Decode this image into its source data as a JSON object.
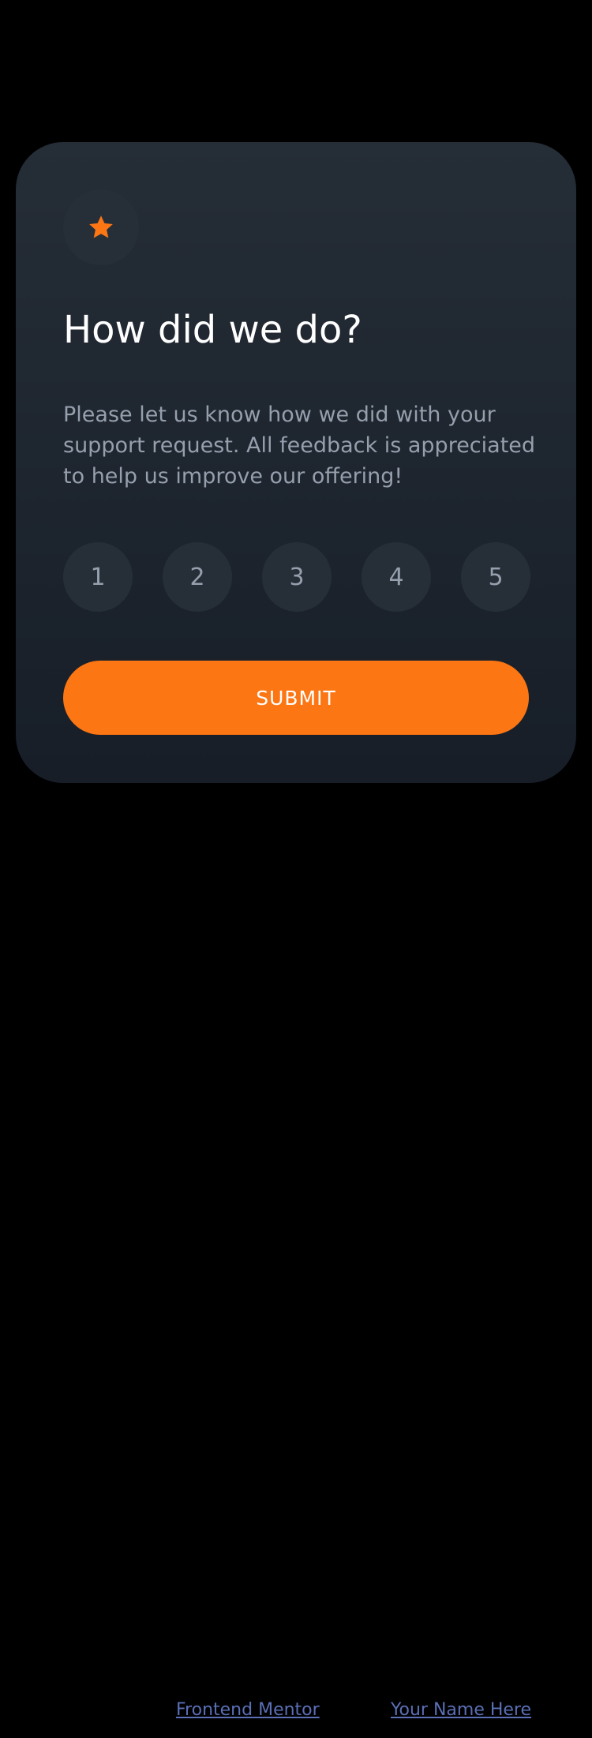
{
  "card": {
    "icon": "star-icon",
    "title": "How did we do?",
    "description": "Please let us know how we did with your support request. All feedback is appreciated to help us improve our offering!",
    "ratings": [
      "1",
      "2",
      "3",
      "4",
      "5"
    ],
    "submit_label": "SUBMIT"
  },
  "attribution": {
    "frontend_mentor": "Frontend Mentor",
    "author": "Your Name Here"
  },
  "colors": {
    "accent": "#FC7614",
    "background": "#000000",
    "card_top": "#252D37",
    "card_bottom": "#171E28",
    "muted_text": "#969FAD",
    "link": "#5A6FB5"
  }
}
